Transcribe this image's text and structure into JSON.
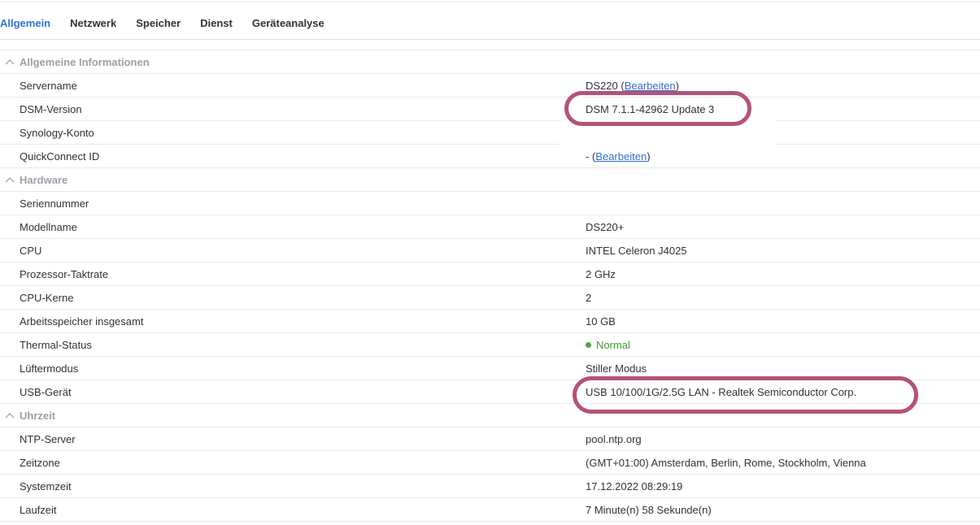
{
  "tabs": [
    {
      "label": "Allgemein",
      "active": true
    },
    {
      "label": "Netzwerk"
    },
    {
      "label": "Speicher"
    },
    {
      "label": "Dienst"
    },
    {
      "label": "Geräteanalyse"
    }
  ],
  "sections": {
    "general": {
      "title": "Allgemeine Informationen",
      "server_name": {
        "label": "Servername",
        "value": "DS220",
        "paren_open": " (",
        "edit_link": "Bearbeiten",
        "paren_close": ")"
      },
      "dsm_version": {
        "label": "DSM-Version",
        "value": "DSM 7.1.1-42962 Update 3"
      },
      "synology_account": {
        "label": "Synology-Konto",
        "value": ""
      },
      "quickconnect": {
        "label": "QuickConnect ID",
        "value": "-",
        "paren_open": " (",
        "edit_link": "Bearbeiten",
        "paren_close": ")"
      }
    },
    "hardware": {
      "title": "Hardware",
      "serial": {
        "label": "Seriennummer",
        "value": ""
      },
      "model": {
        "label": "Modellname",
        "value": "DS220+"
      },
      "cpu": {
        "label": "CPU",
        "value": "INTEL Celeron J4025"
      },
      "clock": {
        "label": "Prozessor-Taktrate",
        "value": "2 GHz"
      },
      "cores": {
        "label": "CPU-Kerne",
        "value": "2"
      },
      "memory": {
        "label": "Arbeitsspeicher insgesamt",
        "value": "10 GB"
      },
      "thermal": {
        "label": "Thermal-Status",
        "value": "Normal"
      },
      "fan": {
        "label": "Lüftermodus",
        "value": "Stiller Modus"
      },
      "usb": {
        "label": "USB-Gerät",
        "value": "USB 10/100/1G/2.5G LAN - Realtek Semiconductor Corp."
      }
    },
    "time": {
      "title": "Uhrzeit",
      "ntp": {
        "label": "NTP-Server",
        "value": "pool.ntp.org"
      },
      "timezone": {
        "label": "Zeitzone",
        "value": "(GMT+01:00) Amsterdam, Berlin, Rome, Stockholm, Vienna"
      },
      "systime": {
        "label": "Systemzeit",
        "value": "17.12.2022 08:29:19"
      },
      "uptime": {
        "label": "Laufzeit",
        "value": "7 Minute(n) 58 Sekunde(n)"
      }
    }
  },
  "colors": {
    "accent": "#2f72d6",
    "highlight": "#b5527a",
    "status_ok": "#4fa73b"
  }
}
